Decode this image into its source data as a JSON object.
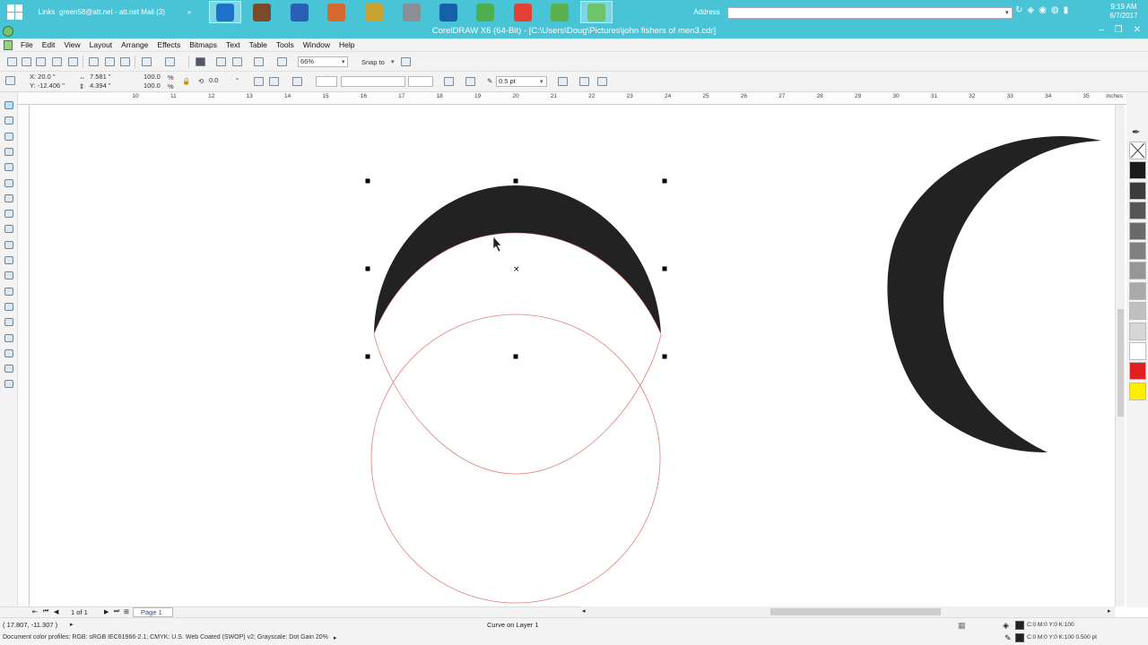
{
  "taskbar": {
    "links_label": "Links",
    "mail_label": "green58@att.net - att.net Mail (3)",
    "overflow": "»",
    "address_label": "Address",
    "address_value": "",
    "clock_time": "9:19 AM",
    "clock_date": "6/7/2017",
    "apps": [
      {
        "name": "internet-explorer",
        "color": "#1e73c8",
        "active": true
      },
      {
        "name": "calendar-app",
        "color": "#7a4a2a",
        "active": false
      },
      {
        "name": "word-app",
        "color": "#2b5fb3",
        "active": false
      },
      {
        "name": "paint-app",
        "color": "#d46a2e",
        "active": false
      },
      {
        "name": "pen-app",
        "color": "#c8a12e",
        "active": false
      },
      {
        "name": "printer-app",
        "color": "#8a8f96",
        "active": false
      },
      {
        "name": "s-app",
        "color": "#1560a8",
        "active": false
      },
      {
        "name": "leaf-app",
        "color": "#4caf50",
        "active": false
      },
      {
        "name": "chrome-app",
        "color": "#e34133",
        "active": false
      },
      {
        "name": "corel-leaf-app",
        "color": "#5bb150",
        "active": false
      },
      {
        "name": "coreldraw-app",
        "color": "#6fc36a",
        "active": true
      }
    ]
  },
  "window": {
    "title": "CorelDRAW X6 (64-Bit) - [C:\\Users\\Doug\\Pictures\\john fishers of men3.cdr]",
    "minimize": "–",
    "restore": "❐",
    "close": "✕"
  },
  "menu": [
    "File",
    "Edit",
    "View",
    "Layout",
    "Arrange",
    "Effects",
    "Bitmaps",
    "Text",
    "Table",
    "Tools",
    "Window",
    "Help"
  ],
  "standard_toolbar": {
    "zoom": "66%",
    "snap_to": "Snap to"
  },
  "property_bar": {
    "x": "X: 20.0 \"",
    "y": "Y: -12.406 \"",
    "width": "7.581 \"",
    "height": "4.394 \"",
    "scale_w": "100.0",
    "scale_h": "100.0",
    "pct": "%",
    "rotation": "0.0",
    "degree": "°",
    "outline_width": "0.5 pt"
  },
  "ruler": {
    "units": "inches",
    "labels": [
      "10",
      "11",
      "12",
      "13",
      "14",
      "15",
      "16",
      "17",
      "18",
      "19",
      "20",
      "21",
      "22",
      "23",
      "24",
      "25",
      "26",
      "27",
      "28",
      "29",
      "30",
      "31",
      "32",
      "33",
      "34",
      "35"
    ]
  },
  "palette": [
    "none",
    "#1a1a1a",
    "#3c3c3c",
    "#555555",
    "#6a6a6a",
    "#808080",
    "#969696",
    "#aaaaaa",
    "#c0c0c0",
    "#d6d6d6",
    "#ffffff",
    "#e02020",
    "#ffee00"
  ],
  "page_nav": {
    "count": "1 of 1",
    "tab": "Page 1"
  },
  "status": {
    "coords": "( 17.807, -11.307 )",
    "object_info": "Curve on Layer 1",
    "profiles": "Document color profiles: RGB: sRGB IEC61966-2.1; CMYK: U.S. Web Coated (SWOP) v2; Grayscale: Dot Gain 20%",
    "fill_info": "C:0 M:0 Y:0 K:100",
    "outline_info": "C:0 M:0 Y:0 K:100  0.500 pt"
  },
  "colors": {
    "accent": "#49c3d6",
    "shape_fill": "#222222",
    "outline_guide": "#e07070"
  }
}
